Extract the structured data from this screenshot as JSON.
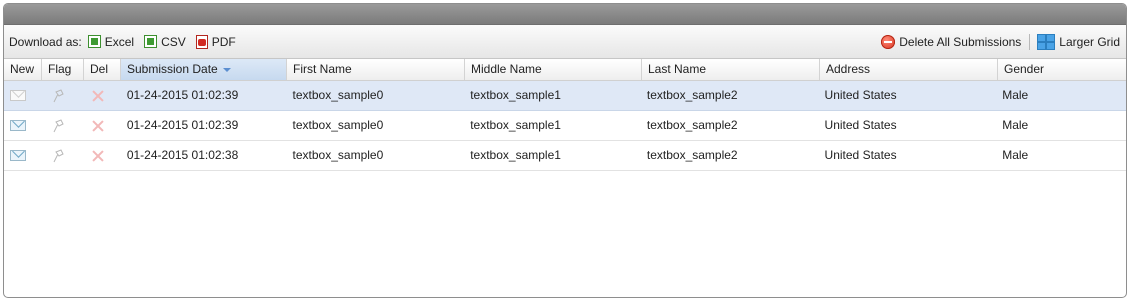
{
  "toolbar": {
    "download_label": "Download as:",
    "excel_label": "Excel",
    "csv_label": "CSV",
    "pdf_label": "PDF",
    "delete_all_label": "Delete All Submissions",
    "larger_grid_label": "Larger Grid"
  },
  "grid": {
    "columns": {
      "new": "New",
      "flag": "Flag",
      "del": "Del",
      "submission_date": "Submission Date",
      "first_name": "First Name",
      "middle_name": "Middle Name",
      "last_name": "Last Name",
      "address": "Address",
      "gender": "Gender"
    },
    "sorted_column": "Submission Date",
    "rows": [
      {
        "read": true,
        "submission_date": "01-24-2015 01:02:39",
        "first_name": "textbox_sample0",
        "middle_name": "textbox_sample1",
        "last_name": "textbox_sample2",
        "address": "United States",
        "gender": "Male"
      },
      {
        "read": false,
        "submission_date": "01-24-2015 01:02:39",
        "first_name": "textbox_sample0",
        "middle_name": "textbox_sample1",
        "last_name": "textbox_sample2",
        "address": "United States",
        "gender": "Male"
      },
      {
        "read": false,
        "submission_date": "01-24-2015 01:02:38",
        "first_name": "textbox_sample0",
        "middle_name": "textbox_sample1",
        "last_name": "textbox_sample2",
        "address": "United States",
        "gender": "Male"
      }
    ]
  },
  "colors": {
    "selected_row": "#dfe8f6",
    "titlebar": "#8a8a8a",
    "sort_arrow": "#5b8ed0"
  }
}
